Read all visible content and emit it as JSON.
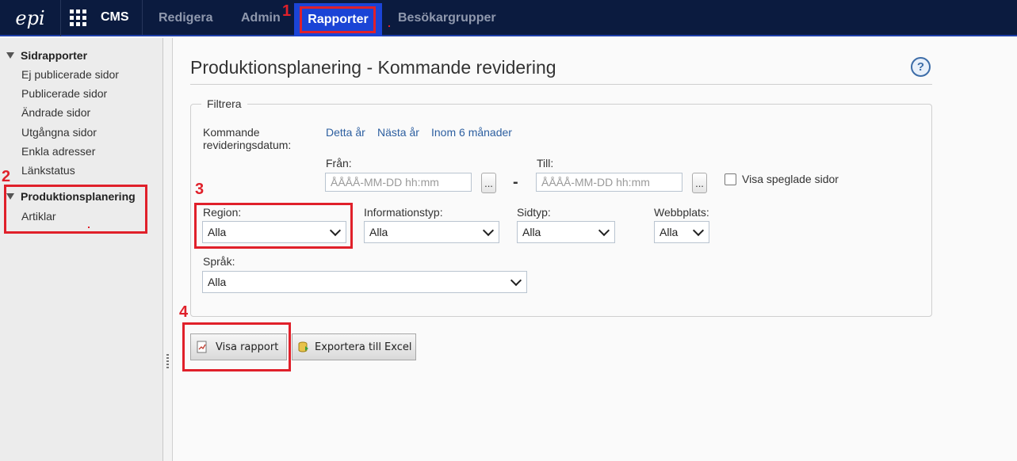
{
  "app": {
    "logo_text": "epi",
    "name": "CMS"
  },
  "nav": {
    "items": [
      {
        "label": "Redigera"
      },
      {
        "label": "Admin"
      },
      {
        "label": "Rapporter",
        "active": true
      },
      {
        "label": "Besökargrupper"
      }
    ]
  },
  "sidebar": {
    "groups": [
      {
        "label": "Sidrapporter",
        "items": [
          "Ej publicerade sidor",
          "Publicerade sidor",
          "Ändrade sidor",
          "Utgångna sidor",
          "Enkla adresser",
          "Länkstatus"
        ]
      },
      {
        "label": "Produktionsplanering",
        "items": [
          "Artiklar"
        ]
      }
    ]
  },
  "page": {
    "title": "Produktionsplanering - Kommande revidering",
    "help_label": "?"
  },
  "filter": {
    "legend": "Filtrera",
    "date_label_line1": "Kommande",
    "date_label_line2": "revideringsdatum:",
    "quick_links": [
      "Detta år",
      "Nästa år",
      "Inom 6 månader"
    ],
    "from_label": "Från:",
    "to_label": "Till:",
    "date_placeholder": "ÅÅÅÅ-MM-DD hh:mm",
    "picker_label": "...",
    "range_dash": "-",
    "mirrored_label": "Visa speglade sidor",
    "region": {
      "label": "Region:",
      "value": "Alla"
    },
    "infotype": {
      "label": "Informationstyp:",
      "value": "Alla"
    },
    "pagetype": {
      "label": "Sidtyp:",
      "value": "Alla"
    },
    "website": {
      "label": "Webbplats:",
      "value": "Alla"
    },
    "language": {
      "label": "Språk:",
      "value": "Alla"
    }
  },
  "actions": {
    "show_report": "Visa rapport",
    "export_excel": "Exportera till Excel"
  },
  "annotations": {
    "m1": "1",
    "m2": "2",
    "m3": "3",
    "m4": "4"
  },
  "colors": {
    "topbar": "#0b1b3f",
    "active_tab": "#1b44d6",
    "annotation_red": "#e0202a",
    "link": "#2d5fa0"
  },
  "icons": [
    "epi-logo-icon",
    "apps-grid-icon",
    "help-icon",
    "chevron-down-icon",
    "report-icon",
    "excel-export-icon",
    "collapse-triangle-icon",
    "splitter-grip-icon"
  ]
}
